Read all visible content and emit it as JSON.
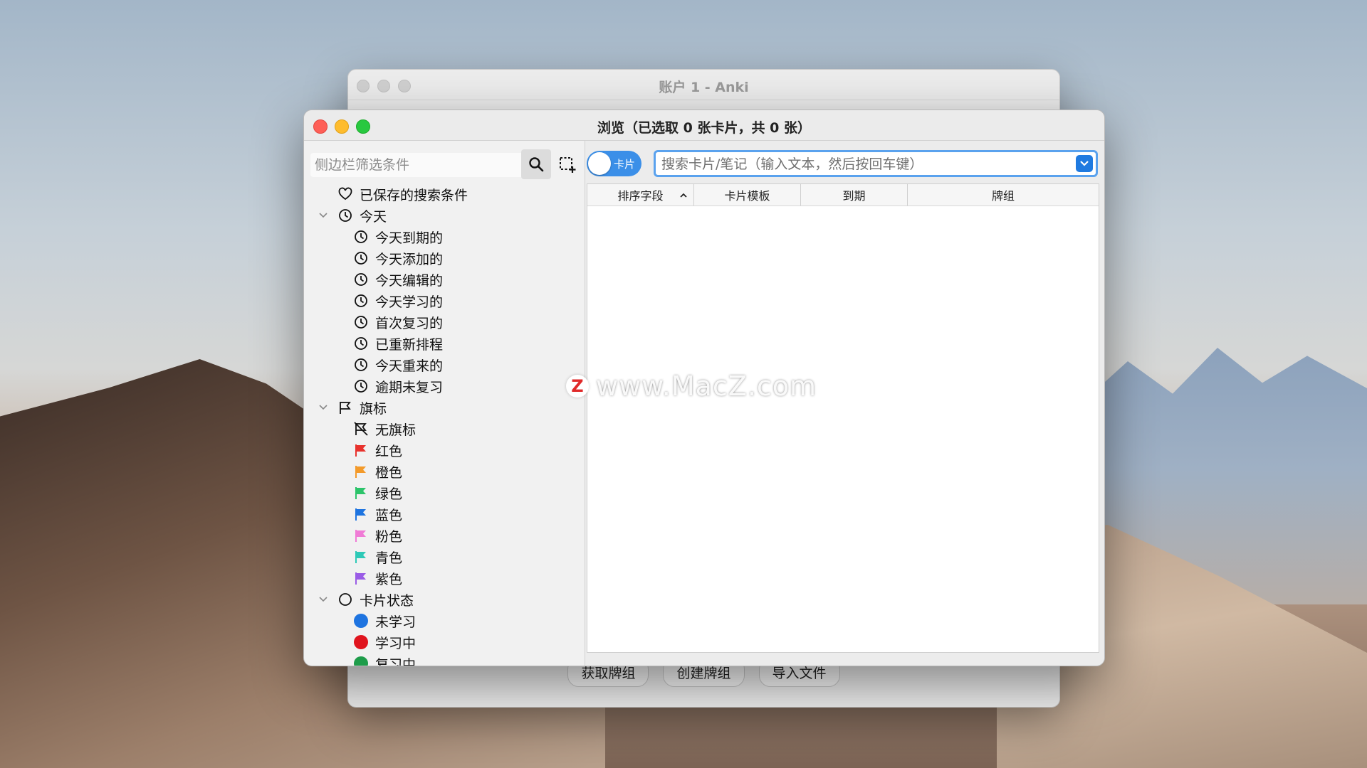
{
  "back_window": {
    "title": "账户 1 - Anki",
    "buttons": [
      "获取牌组",
      "创建牌组",
      "导入文件"
    ]
  },
  "browse_window": {
    "title": "浏览（已选取 0 张卡片，共 0 张）"
  },
  "sidebar": {
    "filter_placeholder": "侧边栏筛选条件",
    "saved_searches": "已保存的搜索条件",
    "today": {
      "label": "今天",
      "items": [
        "今天到期的",
        "今天添加的",
        "今天编辑的",
        "今天学习的",
        "首次复习的",
        "已重新排程",
        "今天重来的",
        "逾期未复习"
      ]
    },
    "flags": {
      "label": "旗标",
      "no_flag": "无旗标",
      "items": [
        {
          "label": "红色",
          "color": "#e8322d"
        },
        {
          "label": "橙色",
          "color": "#f39a2a"
        },
        {
          "label": "绿色",
          "color": "#2cc46a"
        },
        {
          "label": "蓝色",
          "color": "#1e74e0"
        },
        {
          "label": "粉色",
          "color": "#f07bd6"
        },
        {
          "label": "青色",
          "color": "#2ec9b7"
        },
        {
          "label": "紫色",
          "color": "#9a5ce6"
        }
      ]
    },
    "card_state": {
      "label": "卡片状态",
      "items": [
        {
          "label": "未学习",
          "color": "#1e74e0"
        },
        {
          "label": "学习中",
          "color": "#e0141e"
        },
        {
          "label": "复习中",
          "color": "#1e9c4a"
        }
      ]
    }
  },
  "toolbar": {
    "toggle_label": "卡片",
    "search_placeholder": "搜索卡片/笔记（输入文本，然后按回车键）"
  },
  "table": {
    "columns": [
      "排序字段",
      "卡片模板",
      "到期",
      "牌组"
    ]
  },
  "watermark": {
    "logo": "Z",
    "text": "www.MacZ.com"
  }
}
